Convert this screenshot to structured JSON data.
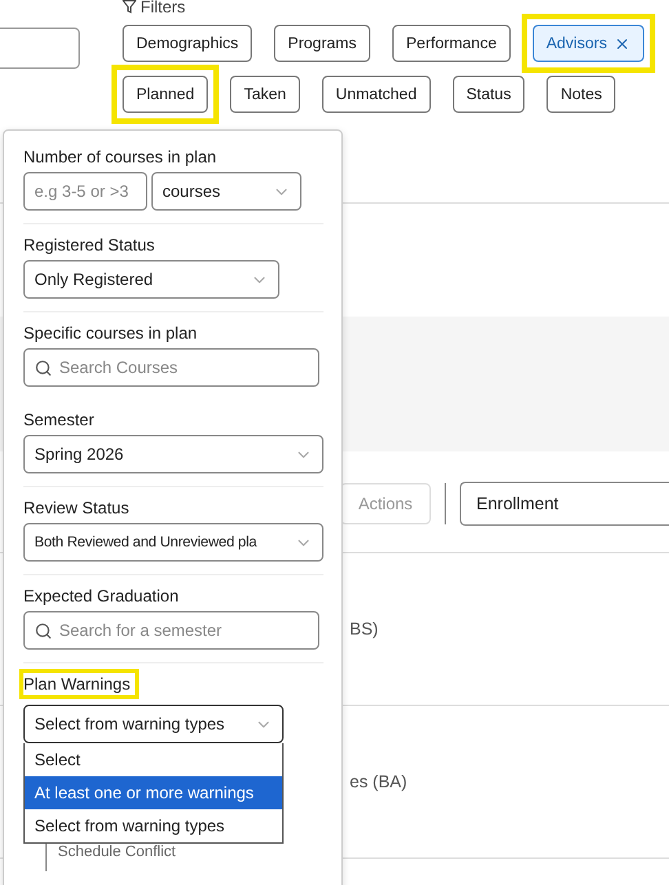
{
  "filters": {
    "label": "Filters",
    "chips": [
      {
        "label": "Demographics",
        "selected": false,
        "highlighted": false
      },
      {
        "label": "Programs",
        "selected": false,
        "highlighted": false
      },
      {
        "label": "Performance",
        "selected": false,
        "highlighted": false
      },
      {
        "label": "Advisors",
        "selected": true,
        "highlighted": true
      },
      {
        "label": "Planned",
        "selected": false,
        "highlighted": true
      },
      {
        "label": "Taken",
        "selected": false,
        "highlighted": false
      },
      {
        "label": "Unmatched",
        "selected": false,
        "highlighted": false
      },
      {
        "label": "Status",
        "selected": false,
        "highlighted": false
      },
      {
        "label": "Notes",
        "selected": false,
        "highlighted": false
      }
    ]
  },
  "toolbar": {
    "actions": {
      "label": "Actions",
      "disabled": true
    },
    "view_select": "Enrollment"
  },
  "list_texts": [
    "BS)",
    "es (BA)"
  ],
  "popover": {
    "sections": [
      {
        "kind": "range",
        "label": "Number of courses in plan",
        "placeholder": "e.g 3-5 or >3",
        "unit": "courses",
        "highlighted": false
      },
      {
        "kind": "select",
        "label": "Registered Status",
        "value": "Only Registered",
        "highlighted": false
      },
      {
        "kind": "search",
        "label": "Specific courses in plan",
        "placeholder": "Search Courses",
        "highlighted": false
      },
      {
        "kind": "select",
        "label": "Semester",
        "value": "Spring 2026",
        "highlighted": false
      },
      {
        "kind": "select",
        "label": "Review Status",
        "value": "Both Reviewed and Unreviewed pla",
        "highlighted": false
      },
      {
        "kind": "search",
        "label": "Expected Graduation",
        "placeholder": "Search for a semester",
        "highlighted": false
      },
      {
        "kind": "open_select",
        "label": "Plan Warnings",
        "value": "Select from warning types",
        "highlighted": true,
        "options": [
          {
            "label": "Select",
            "highlighted": false
          },
          {
            "label": "At least one or more warnings",
            "highlighted": true
          },
          {
            "label": "Select from warning types",
            "highlighted": false
          }
        ],
        "below": "Schedule Conflict"
      }
    ]
  }
}
